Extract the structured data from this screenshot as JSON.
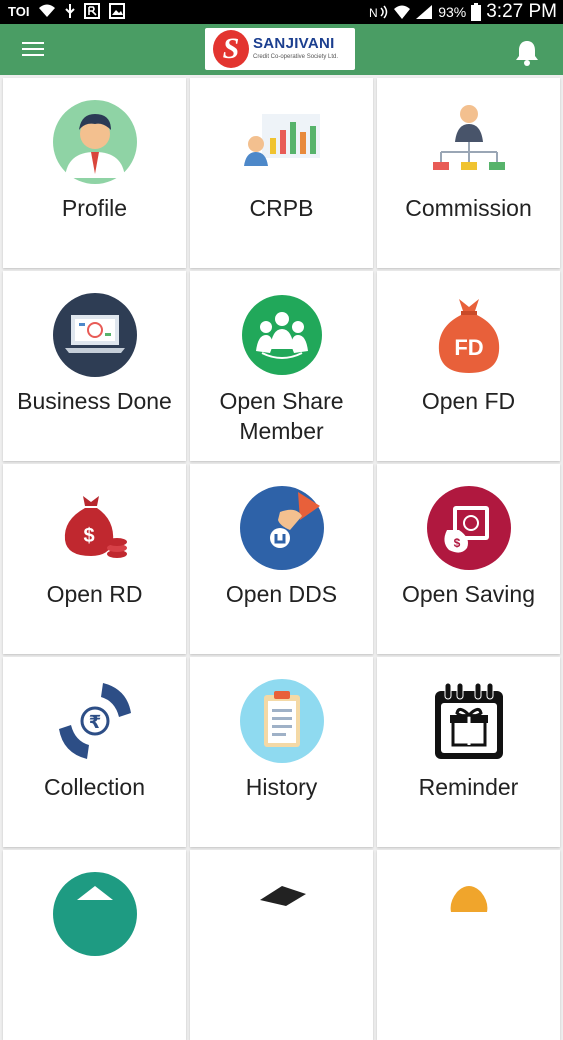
{
  "status_bar": {
    "carrier": "TOI",
    "battery": "93%",
    "time": "3:27 PM"
  },
  "app_bar": {
    "logo_letter": "S",
    "brand_name": "SANJIVANI",
    "brand_subtitle": "Credit Co-operative Society Ltd."
  },
  "tiles": [
    {
      "label": "Profile",
      "icon": "profile-icon"
    },
    {
      "label": "CRPB",
      "icon": "crpb-chart-icon"
    },
    {
      "label": "Commission",
      "icon": "commission-icon"
    },
    {
      "label": "Business Done",
      "icon": "laptop-icon"
    },
    {
      "label": "Open Share\nMember",
      "icon": "group-icon"
    },
    {
      "label": "Open FD",
      "icon": "fd-bag-icon"
    },
    {
      "label": "Open RD",
      "icon": "money-bag-icon"
    },
    {
      "label": "Open DDS",
      "icon": "coin-hand-icon"
    },
    {
      "label": "Open Saving",
      "icon": "safe-icon"
    },
    {
      "label": "Collection",
      "icon": "rupee-hands-icon"
    },
    {
      "label": "History",
      "icon": "clipboard-icon"
    },
    {
      "label": "Reminder",
      "icon": "calendar-gift-icon"
    }
  ],
  "colors": {
    "app_bar": "#4a9d64",
    "status_bar": "#000000",
    "background": "#eeeeee"
  }
}
